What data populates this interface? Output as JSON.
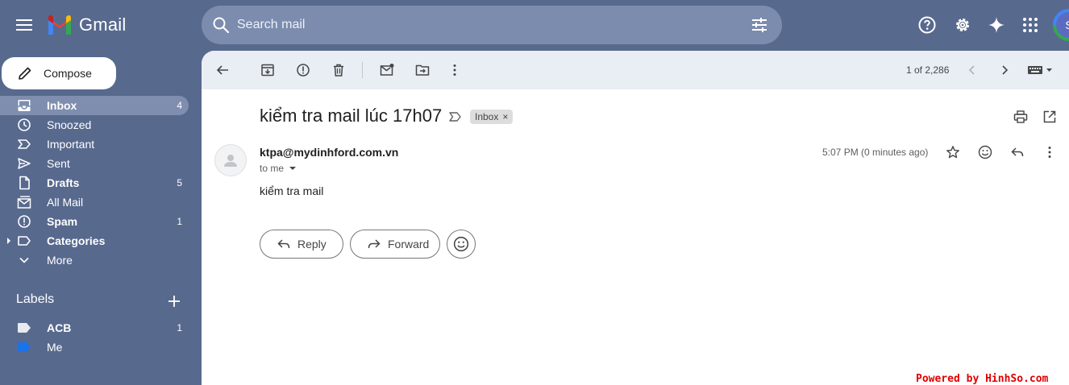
{
  "app": {
    "logo_text": "Gmail",
    "brand_colors": [
      "#4285f4",
      "#ea4335",
      "#fbbc04",
      "#34a853"
    ]
  },
  "search": {
    "placeholder": "Search mail"
  },
  "top_icons": [
    "help-icon",
    "settings-icon",
    "gemini-sparkle-icon",
    "apps-grid-icon"
  ],
  "account": {
    "initial": "S"
  },
  "compose": {
    "label": "Compose"
  },
  "sidebar": {
    "items": [
      {
        "label": "Inbox",
        "count": "4",
        "icon": "inbox-icon",
        "active": true,
        "bold": true
      },
      {
        "label": "Snoozed",
        "count": "",
        "icon": "clock-icon"
      },
      {
        "label": "Important",
        "count": "",
        "icon": "important-icon"
      },
      {
        "label": "Sent",
        "count": "",
        "icon": "send-icon"
      },
      {
        "label": "Drafts",
        "count": "5",
        "icon": "draft-icon",
        "bold": true
      },
      {
        "label": "All Mail",
        "count": "",
        "icon": "all-mail-icon"
      },
      {
        "label": "Spam",
        "count": "1",
        "icon": "spam-icon",
        "bold": true
      },
      {
        "label": "Categories",
        "count": "",
        "icon": "label-icon",
        "bold": true
      },
      {
        "label": "More",
        "count": "",
        "icon": "chevron-down-icon"
      }
    ]
  },
  "labels": {
    "heading": "Labels",
    "items": [
      {
        "label": "ACB",
        "count": "1",
        "color": "#e8eaed"
      },
      {
        "label": "Me",
        "count": "",
        "color": "#1a73e8"
      }
    ]
  },
  "toolbar": {
    "pager_text": "1 of 2,286"
  },
  "message": {
    "subject": "kiểm tra mail lúc 17h07",
    "chip_label": "Inbox",
    "chip_remove": "×",
    "sender": "ktpa@mydinhford.com.vn",
    "recipient": "to me",
    "time": "5:07 PM (0 minutes ago)",
    "body": "kiểm tra mail"
  },
  "actions": {
    "reply": "Reply",
    "forward": "Forward"
  },
  "watermark": "Powered by HinhSo.com"
}
